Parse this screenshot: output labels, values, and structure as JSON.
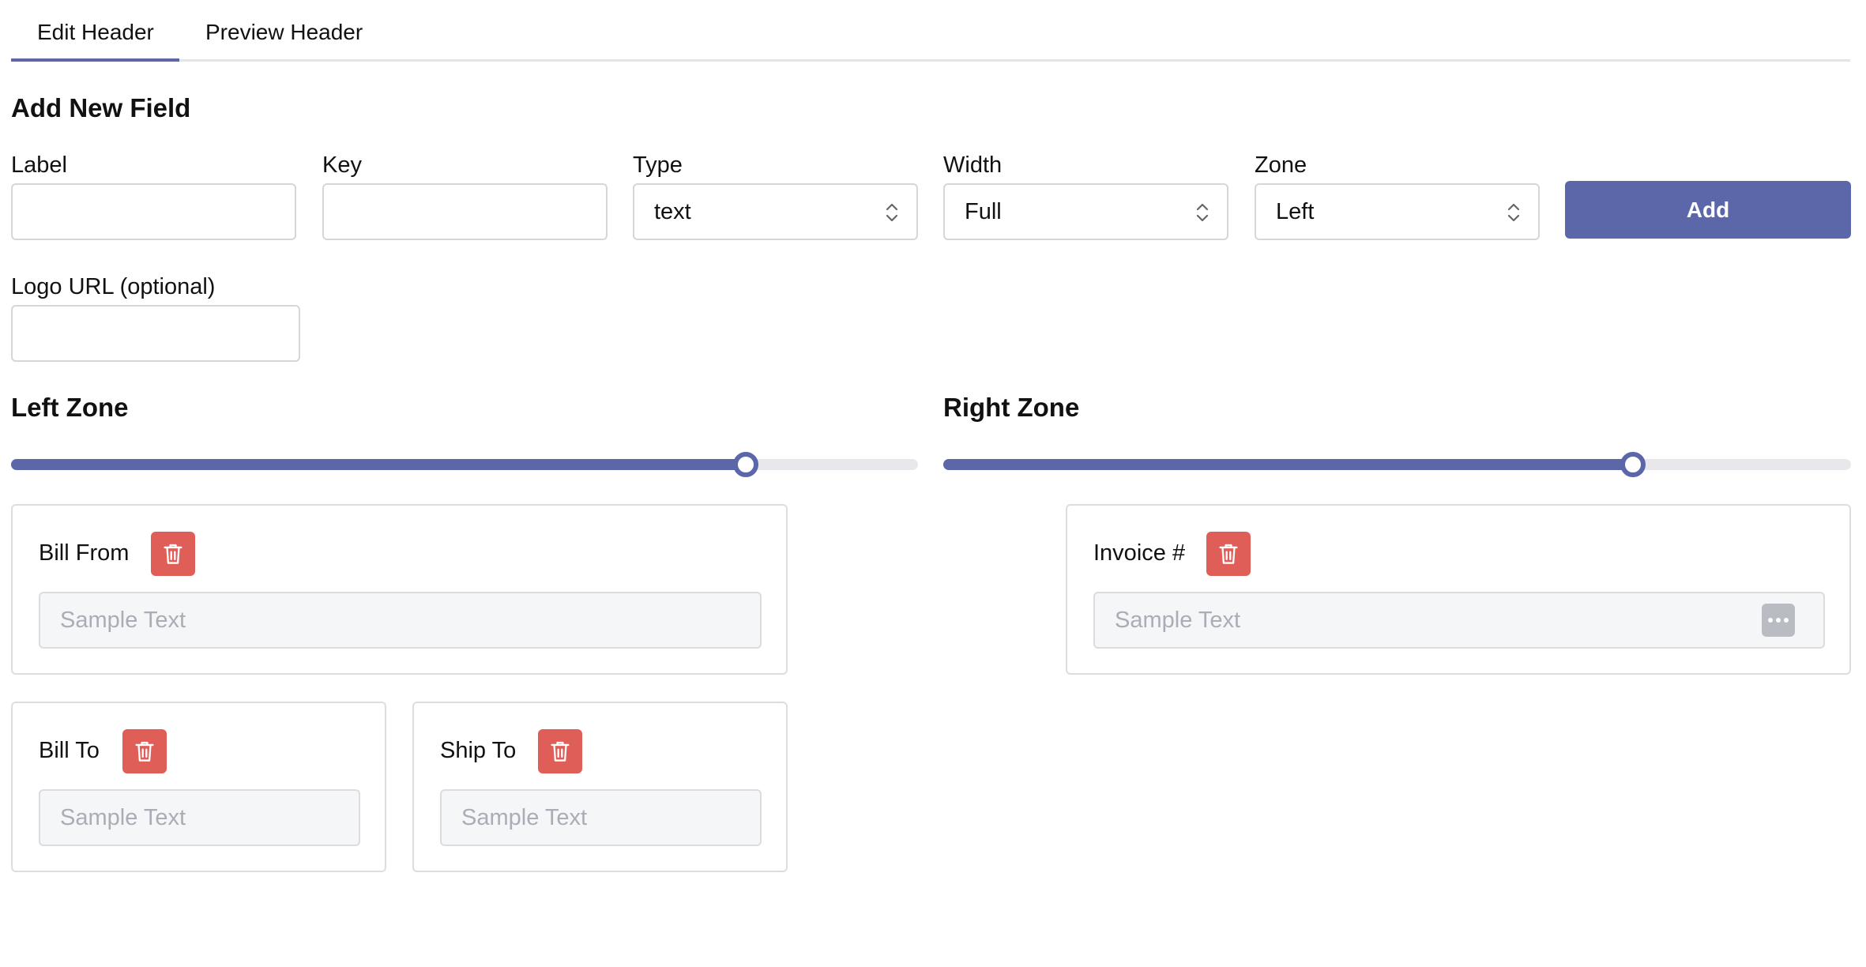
{
  "tabs": [
    {
      "label": "Edit Header",
      "active": true
    },
    {
      "label": "Preview Header",
      "active": false
    }
  ],
  "add_field": {
    "title": "Add New Field",
    "label_label": "Label",
    "label_value": "",
    "key_label": "Key",
    "key_value": "",
    "type_label": "Type",
    "type_value": "text",
    "width_label": "Width",
    "width_value": "Full",
    "zone_label": "Zone",
    "zone_value": "Left",
    "add_button": "Add",
    "logo_label": "Logo URL (optional)",
    "logo_value": ""
  },
  "left_zone": {
    "title": "Left Zone",
    "slider_fraction": 0.81,
    "fields": [
      {
        "label": "Bill From",
        "placeholder": "Sample Text"
      },
      {
        "label": "Bill To",
        "placeholder": "Sample Text"
      },
      {
        "label": "Ship To",
        "placeholder": "Sample Text"
      }
    ]
  },
  "right_zone": {
    "title": "Right Zone",
    "slider_fraction": 0.76,
    "fields": [
      {
        "label": "Invoice #",
        "placeholder": "Sample Text"
      }
    ]
  },
  "colors": {
    "accent": "#5b67a8",
    "delete": "#e05e58"
  },
  "icons": {
    "delete": "trash-icon",
    "select": "chevron-updown-icon",
    "more": "ellipsis-icon"
  }
}
